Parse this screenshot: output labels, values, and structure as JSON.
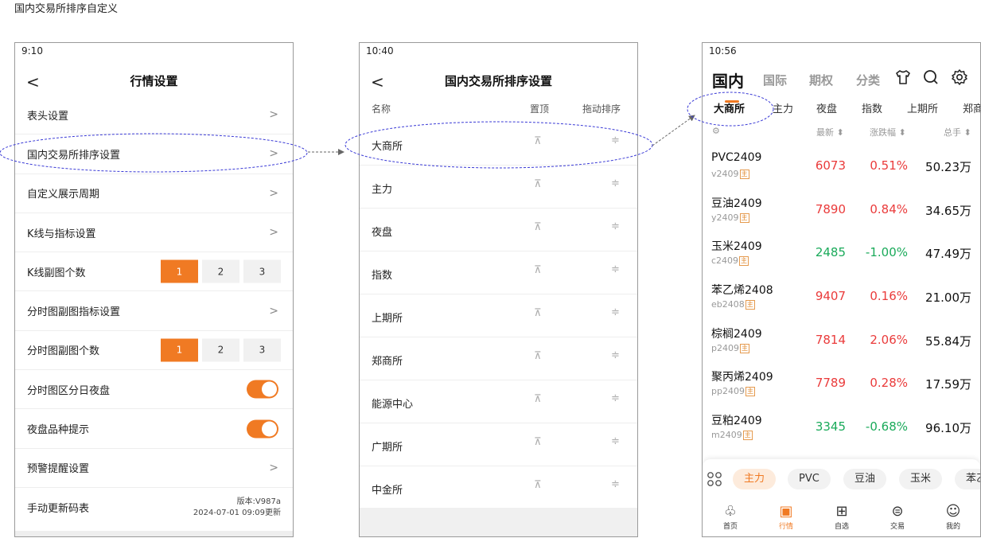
{
  "doc_title": "国内交易所排序自定义",
  "p1": {
    "time": "9:10",
    "back": "<",
    "title": "行情设置",
    "chevron": ">",
    "rows": [
      {
        "label": "表头设置"
      },
      {
        "label": "国内交易所排序设置"
      },
      {
        "label": "自定义展示周期"
      },
      {
        "label": "K线与指标设置"
      },
      {
        "label": "K线副图个数",
        "options": [
          "1",
          "2",
          "3"
        ],
        "selected": "1"
      },
      {
        "label": "分时图副图指标设置"
      },
      {
        "label": "分时图副图个数",
        "options": [
          "1",
          "2",
          "3"
        ],
        "selected": "1"
      },
      {
        "label": "分时图区分日夜盘",
        "toggle": true
      },
      {
        "label": "夜盘品种提示",
        "toggle": true
      },
      {
        "label": "预警提醒设置"
      },
      {
        "label": "手动更新码表",
        "version": "版本:V987a",
        "updated": "2024-07-01 09:09更新"
      }
    ]
  },
  "p2": {
    "time": "10:40",
    "back": "<",
    "title": "国内交易所排序设置",
    "headers": {
      "name": "名称",
      "pin": "置顶",
      "drag": "拖动排序"
    },
    "pin_glyph": "⊼",
    "drag_glyph": "≑",
    "items": [
      "大商所",
      "主力",
      "夜盘",
      "指数",
      "上期所",
      "郑商所",
      "能源中心",
      "广期所",
      "中金所"
    ]
  },
  "p3": {
    "time": "10:56",
    "top_tabs": [
      "国内",
      "国际",
      "期权",
      "分类"
    ],
    "exchange_tabs": [
      "大商所",
      "主力",
      "夜盘",
      "指数",
      "上期所",
      "郑商"
    ],
    "col_headers": {
      "price": "最新 ⬍",
      "change": "涨跌幅 ⬍",
      "volume": "总手 ⬍"
    },
    "quotes": [
      {
        "name": "PVC2409",
        "code": "v2409",
        "tag": "主",
        "price": "6073",
        "change": "0.51%",
        "vol": "50.23万",
        "dir": "up"
      },
      {
        "name": "豆油2409",
        "code": "y2409",
        "tag": "主",
        "price": "7890",
        "change": "0.84%",
        "vol": "34.65万",
        "dir": "up"
      },
      {
        "name": "玉米2409",
        "code": "c2409",
        "tag": "主",
        "price": "2485",
        "change": "-1.00%",
        "vol": "47.49万",
        "dir": "down"
      },
      {
        "name": "苯乙烯2408",
        "code": "eb2408",
        "tag": "主",
        "price": "9407",
        "change": "0.16%",
        "vol": "21.00万",
        "dir": "up"
      },
      {
        "name": "棕榈2409",
        "code": "p2409",
        "tag": "主",
        "price": "7814",
        "change": "2.06%",
        "vol": "55.84万",
        "dir": "up"
      },
      {
        "name": "聚丙烯2409",
        "code": "pp2409",
        "tag": "主",
        "price": "7789",
        "change": "0.28%",
        "vol": "17.59万",
        "dir": "up"
      },
      {
        "name": "豆粕2409",
        "code": "m2409",
        "tag": "主",
        "price": "3345",
        "change": "-0.68%",
        "vol": "96.10万",
        "dir": "down"
      }
    ],
    "chips": [
      "主力",
      "PVC",
      "豆油",
      "玉米",
      "苯乙"
    ],
    "bottom_nav": [
      "首页",
      "行情",
      "自选",
      "交易",
      "我的"
    ],
    "colors": {
      "accent": "#f07a23",
      "up": "#ea3b3b",
      "down": "#1aaa5a",
      "highlight_ellipse": "#3a3ad6"
    }
  }
}
